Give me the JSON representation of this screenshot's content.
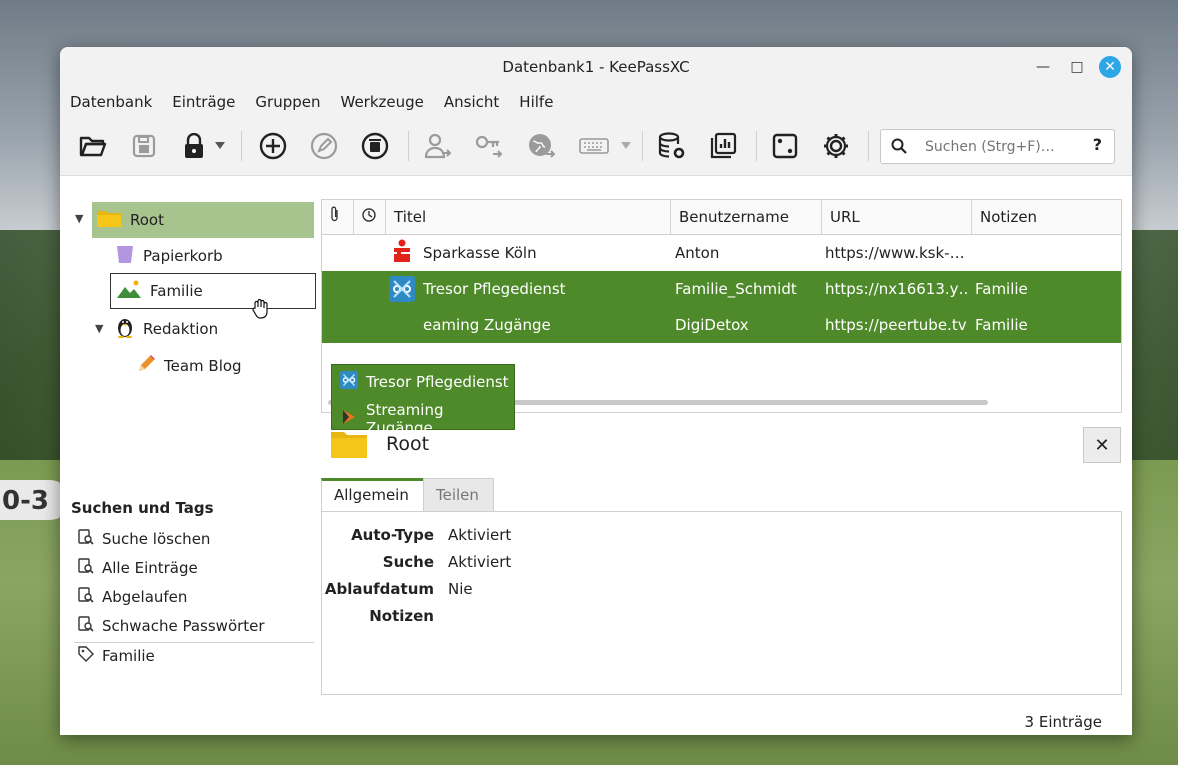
{
  "window": {
    "title": "Datenbank1 - KeePassXC",
    "minimize": "—",
    "maximize": "□",
    "close": "✕"
  },
  "menu": [
    "Datenbank",
    "Einträge",
    "Gruppen",
    "Werkzeuge",
    "Ansicht",
    "Hilfe"
  ],
  "toolbar": {
    "icons": [
      "open-database-icon",
      "save-database-icon",
      "lock-database-icon",
      "add-entry-icon",
      "edit-entry-icon",
      "delete-entry-icon",
      "copy-username-icon",
      "copy-password-icon",
      "open-url-icon",
      "autotype-icon",
      "database-settings-icon",
      "reports-icon",
      "password-generator-icon",
      "settings-icon"
    ],
    "search_placeholder": "Suchen (Strg+F)…",
    "search_help": "?"
  },
  "groups": {
    "root": "Root",
    "children": [
      {
        "label": "Papierkorb",
        "icon": "trash-icon"
      },
      {
        "label": "Familie",
        "icon": "image-icon"
      },
      {
        "label": "Redaktion",
        "icon": "linux-penguin-icon"
      },
      {
        "label": "Team Blog",
        "icon": "pencil-icon"
      }
    ]
  },
  "search_tags": {
    "title": "Suchen und Tags",
    "items": [
      "Suche löschen",
      "Alle Einträge",
      "Abgelaufen",
      "Schwache Passwörter"
    ],
    "tags": [
      "Familie"
    ]
  },
  "table": {
    "columns": [
      "Titel",
      "Benutzername",
      "URL",
      "Notizen"
    ],
    "rows": [
      {
        "title": "Sparkasse Köln",
        "username": "Anton",
        "url": "https://www.ksk-…",
        "notes": "",
        "selected": false
      },
      {
        "title": "Tresor Pflegedienst",
        "username": "Familie_Schmidt",
        "url": "https://nx16613.y…",
        "notes": "Familie",
        "selected": true
      },
      {
        "title": "Streaming Zugänge",
        "username": "DigiDetox",
        "url": "https://peertube.tv",
        "notes": "Familie",
        "selected": true
      }
    ],
    "row3_visible_title": "eaming Zugänge"
  },
  "drag_tooltip": [
    "Tresor Pflegedienst",
    "Streaming Zugänge"
  ],
  "detail": {
    "title": "Root",
    "close": "✕",
    "tabs": [
      "Allgemein",
      "Teilen"
    ],
    "fields": [
      {
        "key": "Auto-Type",
        "value": "Aktiviert"
      },
      {
        "key": "Suche",
        "value": "Aktiviert"
      },
      {
        "key": "Ablaufdatum",
        "value": "Nie"
      },
      {
        "key": "Notizen",
        "value": ""
      }
    ]
  },
  "status": "3 Einträge",
  "colors": {
    "accent": "#4f8a2a",
    "selected_group": "#a8c48e",
    "close_button": "#2da6e8"
  }
}
